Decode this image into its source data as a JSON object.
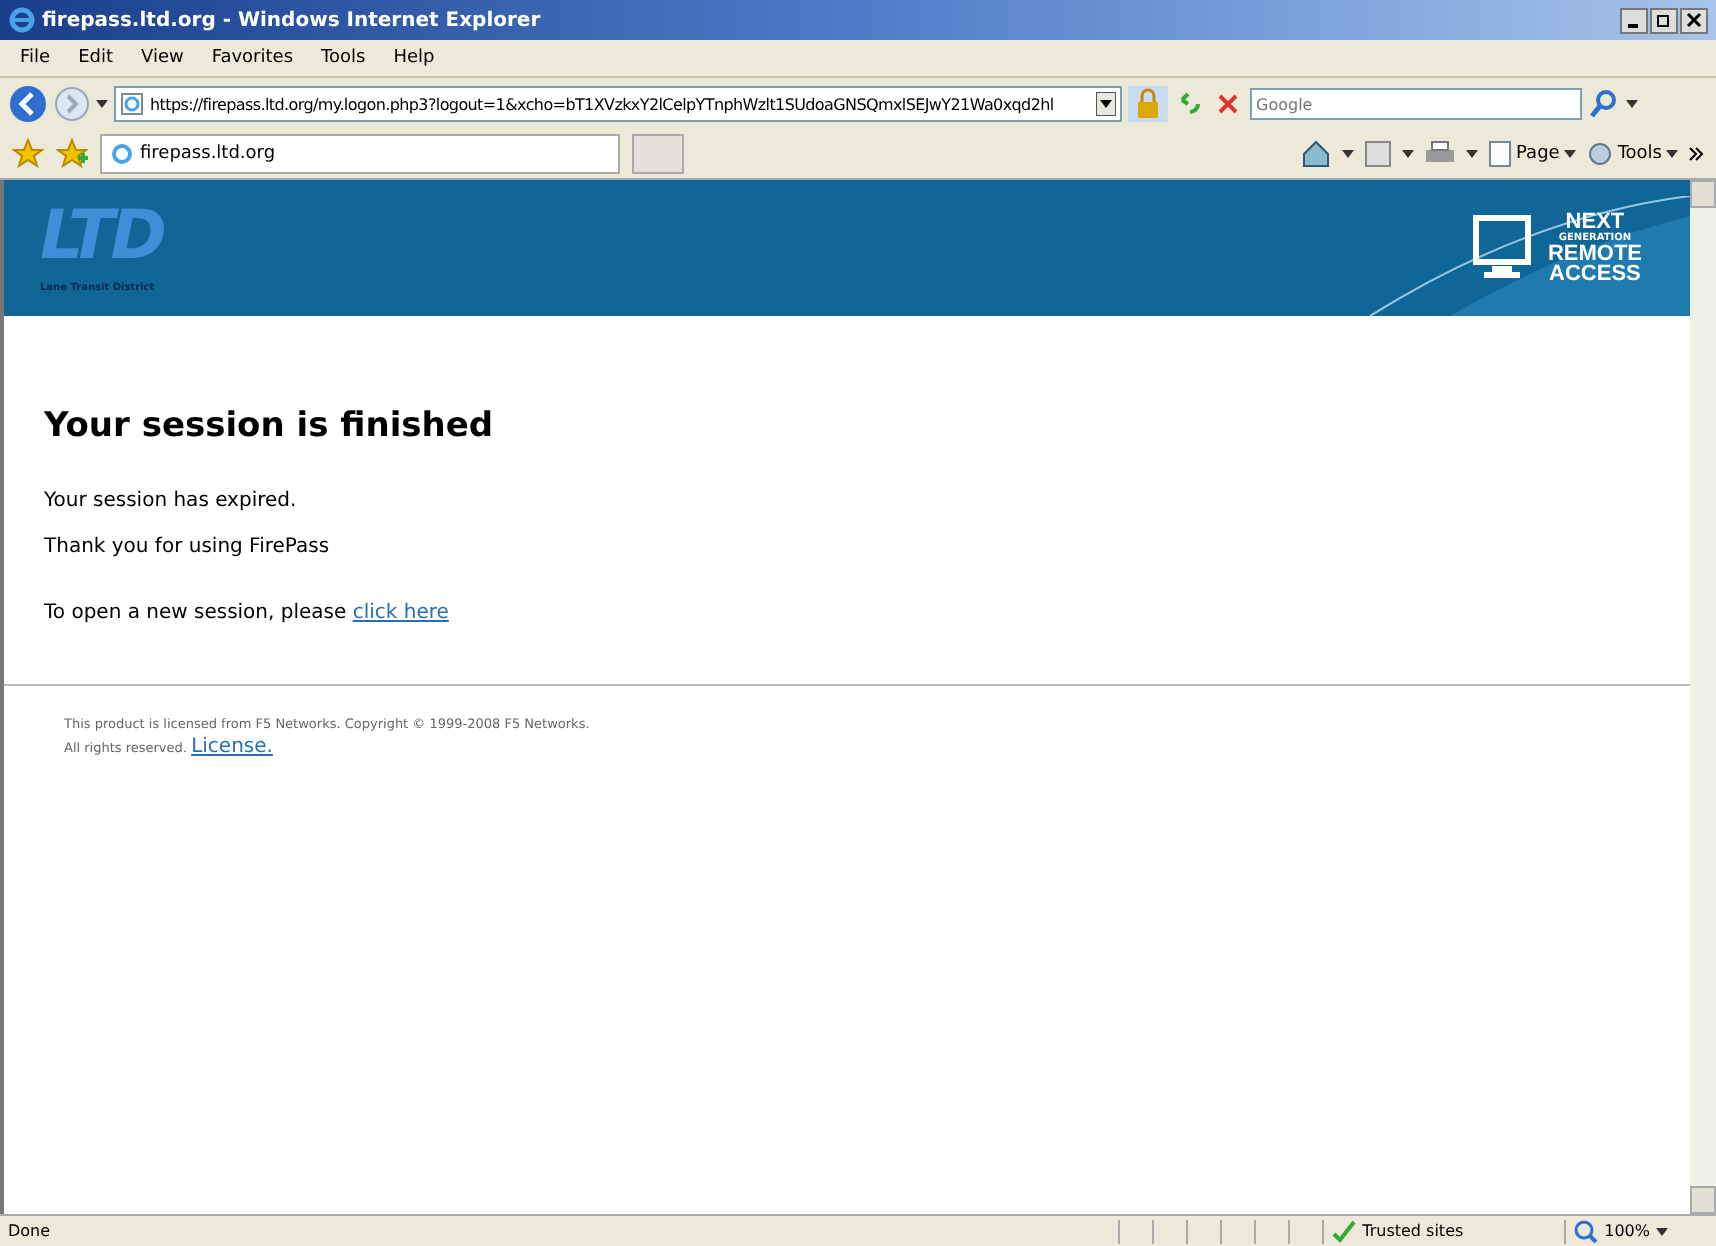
{
  "window": {
    "title": "firepass.ltd.org - Windows Internet Explorer"
  },
  "menu": [
    "File",
    "Edit",
    "View",
    "Favorites",
    "Tools",
    "Help"
  ],
  "address": {
    "value": "https://firepass.ltd.org/my.logon.php3?logout=1&xcho=bT1XVzkxY2lCelpYTnphWzlt1SUdoaGNSQmxlSEJwY21Wa0xqd2hl"
  },
  "search": {
    "placeholder": "Google"
  },
  "tabs": [
    {
      "label": "firepass.ltd.org",
      "selected": true
    }
  ],
  "command_bar": [
    "Page",
    "Tools"
  ],
  "banner": {
    "logo": "LTD",
    "logo_caption": "Lane Transit District",
    "tagline": [
      {
        "text": "NEXT",
        "kind": "big"
      },
      {
        "text": "GENERATION",
        "kind": "small"
      },
      {
        "text": "REMOTE",
        "kind": "big"
      },
      {
        "text": "ACCESS",
        "kind": "big"
      }
    ]
  },
  "page": {
    "heading": "Your session is finished",
    "lines": [
      "Your session has expired.",
      "Thank you for using FirePass"
    ],
    "new_session": {
      "text": "To open a new session, please ",
      "link": "click here"
    }
  },
  "footer": {
    "text": "This product is licensed from F5 Networks. Copyright © 1999-2008 F5 Networks.",
    "text2": "All rights reserved.",
    "link": "License."
  },
  "status_bar": {
    "text": "Done",
    "zone": "Trusted sites",
    "zoom": "100%"
  }
}
